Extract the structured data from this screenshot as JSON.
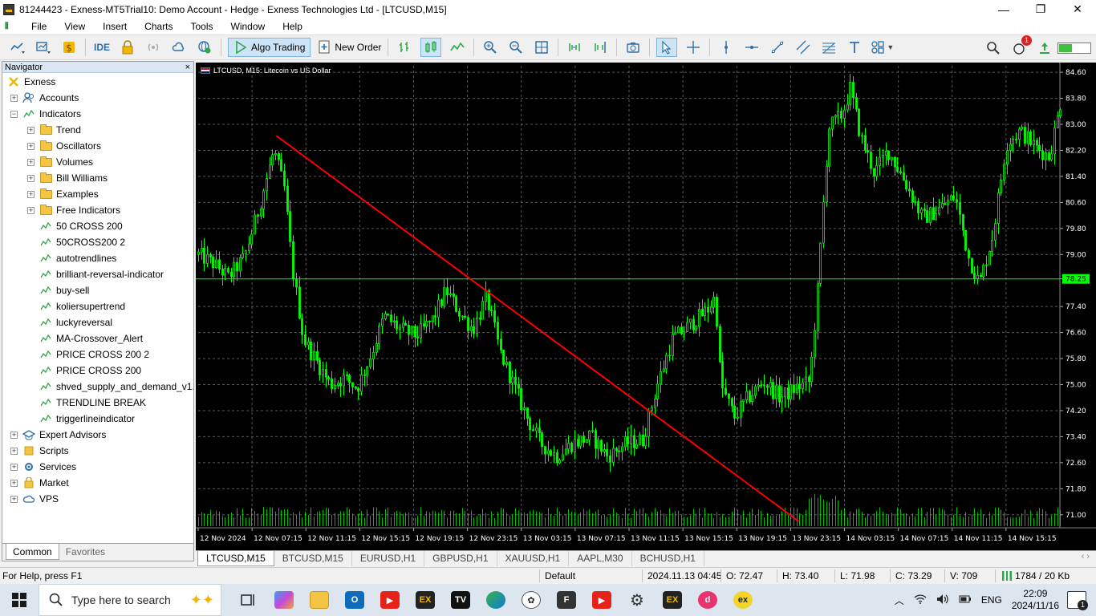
{
  "window": {
    "title": "81244423 - Exness-MT5Trial10: Demo Account - Hedge - Exness Technologies Ltd - [LTCUSD,M15]",
    "minimize": "—",
    "restore": "❐",
    "close": "✕"
  },
  "menu": [
    "File",
    "View",
    "Insert",
    "Charts",
    "Tools",
    "Window",
    "Help"
  ],
  "toolbar": {
    "ide_label": "IDE",
    "algo_trading_label": "Algo Trading",
    "new_order_label": "New Order",
    "notification_count": "1"
  },
  "navigator": {
    "title": "Navigator",
    "close": "×",
    "items": [
      {
        "label": "Exness",
        "level": 0,
        "expander": "",
        "icon": "exness"
      },
      {
        "label": "Accounts",
        "level": 1,
        "expander": "+",
        "icon": "accounts"
      },
      {
        "label": "Indicators",
        "level": 1,
        "expander": "−",
        "icon": "indicator"
      },
      {
        "label": "Trend",
        "level": 2,
        "expander": "+",
        "icon": "folder"
      },
      {
        "label": "Oscillators",
        "level": 2,
        "expander": "+",
        "icon": "folder"
      },
      {
        "label": "Volumes",
        "level": 2,
        "expander": "+",
        "icon": "folder"
      },
      {
        "label": "Bill Williams",
        "level": 2,
        "expander": "+",
        "icon": "folder"
      },
      {
        "label": "Examples",
        "level": 2,
        "expander": "+",
        "icon": "folder"
      },
      {
        "label": "Free Indicators",
        "level": 2,
        "expander": "+",
        "icon": "folder"
      },
      {
        "label": "50 CROSS 200",
        "level": 2,
        "expander": "",
        "icon": "indicator"
      },
      {
        "label": "50CROSS200 2",
        "level": 2,
        "expander": "",
        "icon": "indicator"
      },
      {
        "label": "autotrendlines",
        "level": 2,
        "expander": "",
        "icon": "indicator"
      },
      {
        "label": "brilliant-reversal-indicator",
        "level": 2,
        "expander": "",
        "icon": "indicator"
      },
      {
        "label": "buy-sell",
        "level": 2,
        "expander": "",
        "icon": "indicator"
      },
      {
        "label": "koliersupertrend",
        "level": 2,
        "expander": "",
        "icon": "indicator"
      },
      {
        "label": "luckyreversal",
        "level": 2,
        "expander": "",
        "icon": "indicator"
      },
      {
        "label": "MA-Crossover_Alert",
        "level": 2,
        "expander": "",
        "icon": "indicator"
      },
      {
        "label": "PRICE CROSS 200 2",
        "level": 2,
        "expander": "",
        "icon": "indicator"
      },
      {
        "label": "PRICE CROSS 200",
        "level": 2,
        "expander": "",
        "icon": "indicator"
      },
      {
        "label": "shved_supply_and_demand_v1.",
        "level": 2,
        "expander": "",
        "icon": "indicator"
      },
      {
        "label": "TRENDLINE BREAK",
        "level": 2,
        "expander": "",
        "icon": "indicator"
      },
      {
        "label": "triggerlineindicator",
        "level": 2,
        "expander": "",
        "icon": "indicator"
      },
      {
        "label": "Expert Advisors",
        "level": 1,
        "expander": "+",
        "icon": "expert"
      },
      {
        "label": "Scripts",
        "level": 1,
        "expander": "+",
        "icon": "scripts"
      },
      {
        "label": "Services",
        "level": 1,
        "expander": "+",
        "icon": "services"
      },
      {
        "label": "Market",
        "level": 1,
        "expander": "+",
        "icon": "market"
      },
      {
        "label": "VPS",
        "level": 1,
        "expander": "+",
        "icon": "vps"
      }
    ],
    "tabs": [
      "Common",
      "Favorites"
    ]
  },
  "chart": {
    "title": "LTCUSD, M15:  Litecoin vs US Dollar",
    "current_price_label": "78.25",
    "colors": {
      "background": "#000000",
      "candles": "#00ff00",
      "trendline": "#ff0000",
      "grid": "#5a5a5a",
      "axis_text": "#ffffff"
    }
  },
  "chart_data": {
    "type": "candlestick",
    "symbol": "LTCUSD",
    "timeframe": "M15",
    "price_ticks": [
      "84.60",
      "83.80",
      "83.00",
      "82.20",
      "81.40",
      "80.60",
      "79.80",
      "79.00",
      "78.25",
      "77.40",
      "76.60",
      "75.80",
      "75.00",
      "74.20",
      "73.40",
      "72.60",
      "71.80",
      "71.00"
    ],
    "time_ticks": [
      "12 Nov 2024",
      "12 Nov 07:15",
      "12 Nov 11:15",
      "12 Nov 15:15",
      "12 Nov 19:15",
      "12 Nov 23:15",
      "13 Nov 03:15",
      "13 Nov 07:15",
      "13 Nov 11:15",
      "13 Nov 15:15",
      "13 Nov 19:15",
      "13 Nov 23:15",
      "14 Nov 03:15",
      "14 Nov 07:15",
      "14 Nov 11:15",
      "14 Nov 15:15"
    ],
    "ylim": [
      70.6,
      84.8
    ],
    "current_price": 78.25,
    "trendline": {
      "start": {
        "time_index": 1.45,
        "price": 82.65
      },
      "end": {
        "time_index": 11.15,
        "price": 70.8
      }
    },
    "price_path": [
      [
        0.0,
        79.0
      ],
      [
        0.3,
        78.7
      ],
      [
        0.55,
        78.3
      ],
      [
        0.85,
        78.9
      ],
      [
        1.1,
        80.3
      ],
      [
        1.4,
        82.2
      ],
      [
        1.6,
        81.0
      ],
      [
        1.75,
        78.5
      ],
      [
        1.95,
        76.4
      ],
      [
        2.2,
        75.7
      ],
      [
        2.45,
        75.0
      ],
      [
        2.7,
        75.2
      ],
      [
        2.95,
        74.9
      ],
      [
        3.2,
        75.9
      ],
      [
        3.45,
        77.1
      ],
      [
        3.75,
        76.7
      ],
      [
        4.05,
        76.5
      ],
      [
        4.35,
        77.0
      ],
      [
        4.6,
        77.9
      ],
      [
        4.85,
        77.2
      ],
      [
        5.1,
        76.7
      ],
      [
        5.35,
        77.7
      ],
      [
        5.6,
        76.0
      ],
      [
        5.85,
        75.0
      ],
      [
        6.1,
        74.0
      ],
      [
        6.35,
        73.2
      ],
      [
        6.65,
        72.8
      ],
      [
        6.95,
        73.2
      ],
      [
        7.3,
        73.4
      ],
      [
        7.6,
        72.8
      ],
      [
        7.95,
        73.2
      ],
      [
        8.25,
        73.3
      ],
      [
        8.5,
        74.9
      ],
      [
        8.8,
        76.4
      ],
      [
        9.1,
        76.8
      ],
      [
        9.45,
        77.3
      ],
      [
        9.6,
        77.7
      ],
      [
        9.7,
        75.0
      ],
      [
        9.95,
        74.0
      ],
      [
        10.2,
        74.6
      ],
      [
        10.5,
        75.1
      ],
      [
        10.8,
        74.6
      ],
      [
        11.1,
        74.9
      ],
      [
        11.35,
        75.1
      ],
      [
        11.5,
        78.0
      ],
      [
        11.7,
        82.9
      ],
      [
        11.95,
        83.3
      ],
      [
        12.1,
        84.1
      ],
      [
        12.3,
        82.6
      ],
      [
        12.55,
        81.5
      ],
      [
        12.8,
        82.2
      ],
      [
        13.1,
        81.3
      ],
      [
        13.45,
        80.1
      ],
      [
        13.75,
        80.4
      ],
      [
        14.05,
        80.8
      ],
      [
        14.3,
        78.9
      ],
      [
        14.5,
        78.1
      ],
      [
        14.75,
        79.6
      ],
      [
        15.0,
        82.4
      ],
      [
        15.25,
        82.8
      ],
      [
        15.55,
        82.3
      ],
      [
        15.8,
        82.0
      ],
      [
        16.05,
        84.0
      ]
    ]
  },
  "chart_tabs": [
    "LTCUSD,M15",
    "BTCUSD,M15",
    "EURUSD,H1",
    "GBPUSD,H1",
    "XAUUSD,H1",
    "AAPL,M30",
    "BCHUSD,H1"
  ],
  "chart_tab_arrows": "‹ ›",
  "status": {
    "help": "For Help, press F1",
    "profile": "Default",
    "datetime": "2024.11.13 04:45",
    "open": "O: 72.47",
    "high": "H: 73.40",
    "low": "L: 71.98",
    "close": "C: 73.29",
    "volume": "V: 709",
    "traffic": "1784 / 20 Kb"
  },
  "taskbar": {
    "search_placeholder": "Type here to search",
    "language": "ENG",
    "time": "22:09",
    "date": "2024/11/16",
    "notification_count": "1"
  }
}
